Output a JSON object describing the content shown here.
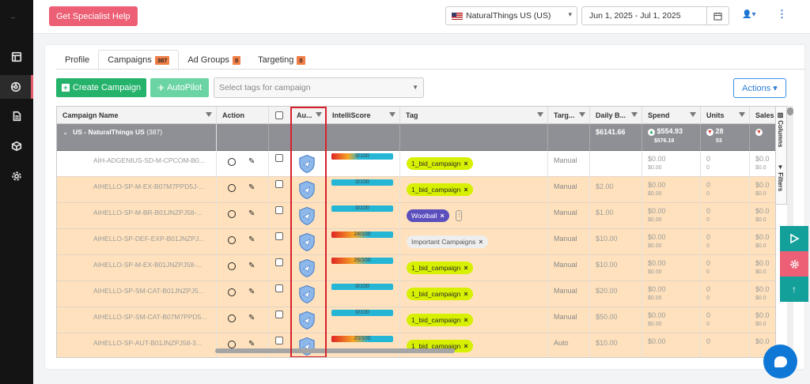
{
  "rail": {
    "mark": "–"
  },
  "topbar": {
    "help_label": "Get Specialist Help",
    "marketplace": "NaturalThings US (US)",
    "date_range": "Jun 1, 2025 - Jul 1, 2025"
  },
  "tabs": [
    {
      "label": "Profile",
      "count": ""
    },
    {
      "label": "Campaigns",
      "count": "387"
    },
    {
      "label": "Ad Groups",
      "count": "0"
    },
    {
      "label": "Targeting",
      "count": "0"
    }
  ],
  "toolbar": {
    "create_label": "Create Campaign",
    "autopilot_label": "AutoPilot",
    "tags_placeholder": "Select tags for campaign",
    "actions_label": "Actions"
  },
  "columns": {
    "name": "Campaign Name",
    "action": "Action",
    "autopilot": "Au...",
    "intelli": "IntelliScore",
    "tag": "Tag",
    "targeting": "Targ...",
    "budget": "Daily B...",
    "spend": "Spend",
    "units": "Units",
    "sales": "Sales"
  },
  "group": {
    "name": "US - NaturalThings US",
    "count": "(387)",
    "budget": "$6141.66",
    "spend": "$554.93",
    "spend_prev": "$576.19",
    "units": "28",
    "units_prev": "53"
  },
  "rows": [
    {
      "name": "AIH-ADGENIUS-SD-M-CPCOM-B0...",
      "intelli": "0/100",
      "intelli_pct": 0.45,
      "tag": "1_bid_campaign",
      "tag_style": "lime",
      "targeting": "Manual",
      "budget": "",
      "spend": "$0.00",
      "spend_prev": "$0.00",
      "units": "0",
      "units_prev": "0",
      "sales": "$0.0",
      "sales_prev": "$0.0",
      "hl": false
    },
    {
      "name": "AIHELLO-SP-M-EX-B07M7PPD5J-...",
      "intelli": "0/100",
      "intelli_pct": 0,
      "tag": "1_bid_campaign",
      "tag_style": "lime",
      "targeting": "Manual",
      "budget": "$2.00",
      "spend": "$0.00",
      "spend_prev": "$0.00",
      "units": "0",
      "units_prev": "0",
      "sales": "$0.0",
      "sales_prev": "$0.0",
      "hl": true
    },
    {
      "name": "AIHELLO-SP-M-BR-B01JNZPJ58-...",
      "intelli": "0/100",
      "intelli_pct": 0,
      "tag": "Woolball",
      "tag_style": "purple",
      "targeting": "Manual",
      "budget": "$1.00",
      "spend": "$0.00",
      "spend_prev": "$0.00",
      "units": "0",
      "units_prev": "0",
      "sales": "$0.0",
      "sales_prev": "$0.0",
      "hl": true
    },
    {
      "name": "AIHELLO-SP-DEF-EXP-B01JNZPJ...",
      "intelli": "24/100",
      "intelli_pct": 0.6,
      "tag": "Important Campaigns",
      "tag_style": "grey",
      "targeting": "Manual",
      "budget": "$10.00",
      "spend": "$0.00",
      "spend_prev": "$0.00",
      "units": "0",
      "units_prev": "0",
      "sales": "$0.0",
      "sales_prev": "$0.0",
      "hl": true
    },
    {
      "name": "AIHELLO-SP-M-EX-B01JNZPJ58-...",
      "intelli": "26/100",
      "intelli_pct": 0.6,
      "tag": "1_bid_campaign",
      "tag_style": "lime",
      "targeting": "Manual",
      "budget": "$10.00",
      "spend": "$0.00",
      "spend_prev": "$0.00",
      "units": "0",
      "units_prev": "0",
      "sales": "$0.0",
      "sales_prev": "$0.0",
      "hl": true
    },
    {
      "name": "AIHELLO-SP-SM-CAT-B01JNZPJ5...",
      "intelli": "0/100",
      "intelli_pct": 0,
      "tag": "1_bid_campaign",
      "tag_style": "lime",
      "targeting": "Manual",
      "budget": "$20.00",
      "spend": "$0.00",
      "spend_prev": "$0.00",
      "units": "0",
      "units_prev": "0",
      "sales": "$0.0",
      "sales_prev": "$0.0",
      "hl": true
    },
    {
      "name": "AIHELLO-SP-SM-CAT-B07M7PPD5...",
      "intelli": "0/100",
      "intelli_pct": 0,
      "tag": "1_bid_campaign",
      "tag_style": "lime",
      "targeting": "Manual",
      "budget": "$50.00",
      "spend": "$0.00",
      "spend_prev": "$0.00",
      "units": "0",
      "units_prev": "0",
      "sales": "$0.0",
      "sales_prev": "$0.0",
      "hl": true
    },
    {
      "name": "AIHELLO-SP-AUT-B01JNZPJ58-3...",
      "intelli": "20/100",
      "intelli_pct": 0.6,
      "tag": "1_bid_campaign",
      "tag_style": "lime",
      "targeting": "Auto",
      "budget": "$10.00",
      "spend": "$0.00",
      "spend_prev": "",
      "units": "0",
      "units_prev": "",
      "sales": "$0.0",
      "sales_prev": "",
      "hl": true
    }
  ],
  "side_labels": {
    "columns": "Columns",
    "filters": "Filters"
  },
  "colors": {
    "highlight": "#ffe2bd",
    "green": "#25b36b",
    "pink": "#ec5f74",
    "teal": "#14a09a",
    "blue": "#0f78d6"
  }
}
